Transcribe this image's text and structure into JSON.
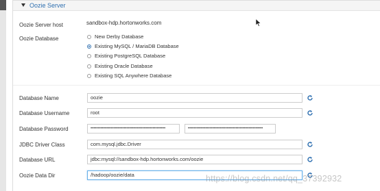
{
  "section": {
    "title": "Oozie Server"
  },
  "server_host": {
    "label": "Oozie Server host",
    "value": "sandbox-hdp.hortonworks.com"
  },
  "database": {
    "label": "Oozie Database",
    "options": [
      {
        "label": "New Derby Database",
        "selected": false
      },
      {
        "label": "Existing MySQL / MariaDB Database",
        "selected": true
      },
      {
        "label": "Existing PostgreSQL Database",
        "selected": false
      },
      {
        "label": "Existing Oracle Database",
        "selected": false
      },
      {
        "label": "Existing SQL Anywhere Database",
        "selected": false
      }
    ]
  },
  "fields": {
    "db_name": {
      "label": "Database Name",
      "value": "oozie"
    },
    "db_username": {
      "label": "Database Username",
      "value": "root"
    },
    "db_password": {
      "label": "Database Password",
      "value": "••••••••••••••••••••••••••••••••••••••••••••••••••••",
      "confirm_value": "••••••••••••••••••••••••••••••••••••••••••••••••••••"
    },
    "jdbc_driver": {
      "label": "JDBC Driver Class",
      "value": "com.mysql.jdbc.Driver"
    },
    "db_url": {
      "label": "Database URL",
      "value": "jdbc:mysql://sandbox-hdp.hortonworks.com/oozie"
    },
    "data_dir": {
      "label": "Oozie Data Dir",
      "value": "/hadoop/oozie/data"
    }
  },
  "icons": {
    "refresh": "refresh-icon",
    "collapse": "caret-down-icon",
    "cursor": "mouse-pointer-icon"
  },
  "colors": {
    "accent": "#2e6fb0",
    "border": "#cccccc",
    "focus_border": "#66afe9"
  },
  "watermark": "https://blog.csdn.net/qq_37392932"
}
